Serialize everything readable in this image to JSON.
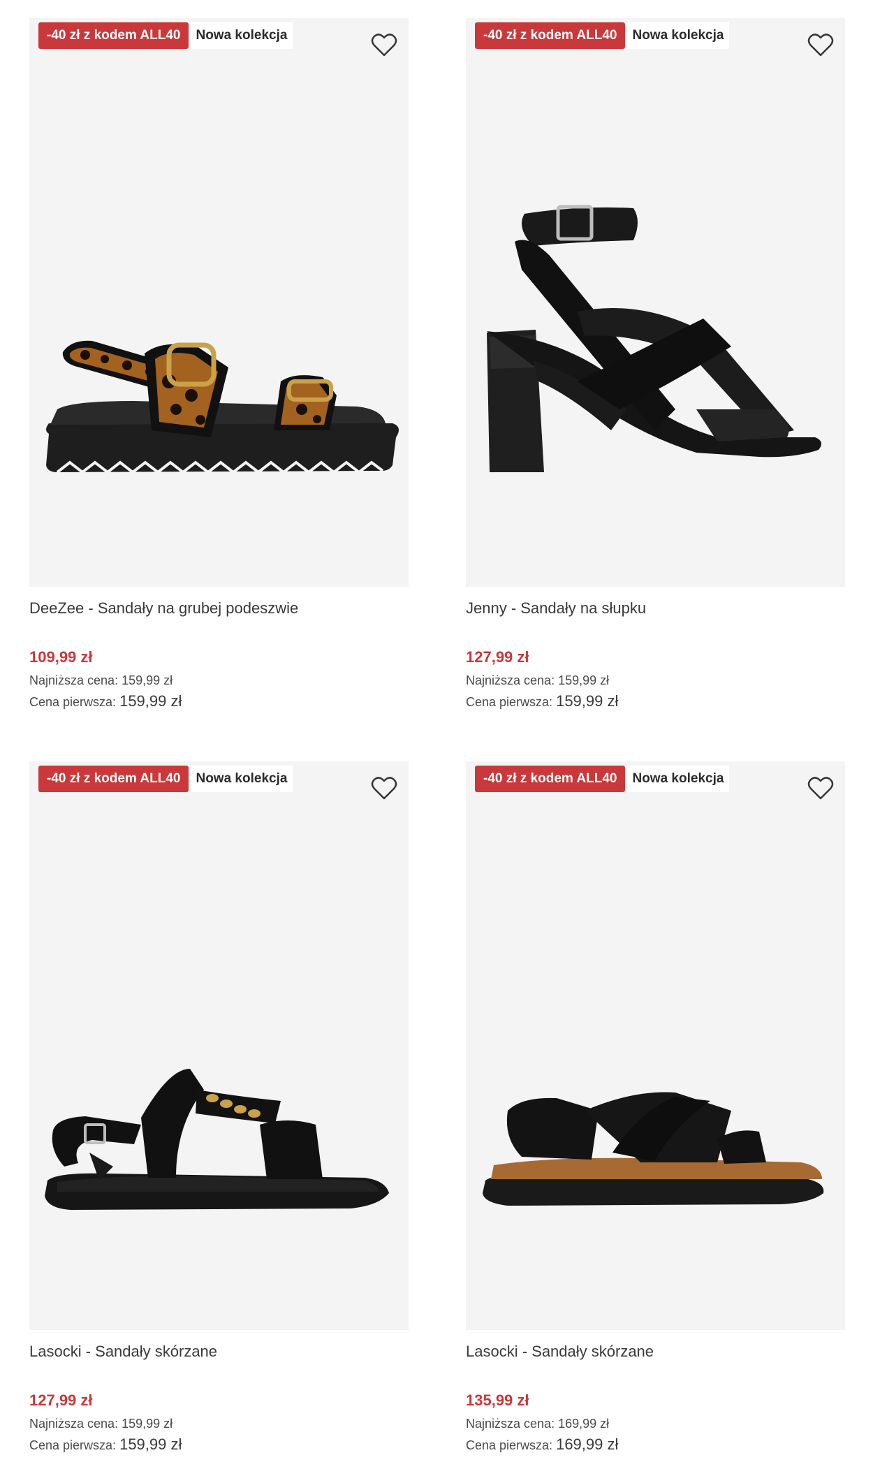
{
  "products": [
    {
      "promo_badge": "-40 zł z kodem ALL40",
      "new_badge": "Nowa kolekcja",
      "title": "DeeZee - Sandały na grubej podeszwie",
      "price": "109,99 zł",
      "lowest_label": "Najniższa cena:",
      "lowest_value": "159,99 zł",
      "first_label": "Cena pierwsza:",
      "first_value": "159,99 zł"
    },
    {
      "promo_badge": "-40 zł z kodem ALL40",
      "new_badge": "Nowa kolekcja",
      "title": "Jenny - Sandały na słupku",
      "price": "127,99 zł",
      "lowest_label": "Najniższa cena:",
      "lowest_value": "159,99 zł",
      "first_label": "Cena pierwsza:",
      "first_value": "159,99 zł"
    },
    {
      "promo_badge": "-40 zł z kodem ALL40",
      "new_badge": "Nowa kolekcja",
      "title": "Lasocki - Sandały skórzane",
      "price": "127,99 zł",
      "lowest_label": "Najniższa cena:",
      "lowest_value": "159,99 zł",
      "first_label": "Cena pierwsza:",
      "first_value": "159,99 zł"
    },
    {
      "promo_badge": "-40 zł z kodem ALL40",
      "new_badge": "Nowa kolekcja",
      "title": "Lasocki - Sandały skórzane",
      "price": "135,99 zł",
      "lowest_label": "Najniższa cena:",
      "lowest_value": "169,99 zł",
      "first_label": "Cena pierwsza:",
      "first_value": "169,99 zł"
    }
  ],
  "icons": {
    "wishlist": "heart-outline-icon"
  },
  "colors": {
    "promo_badge_bg": "#c9383a",
    "price": "#c9383a",
    "photo_bg": "#f4f4f4"
  }
}
